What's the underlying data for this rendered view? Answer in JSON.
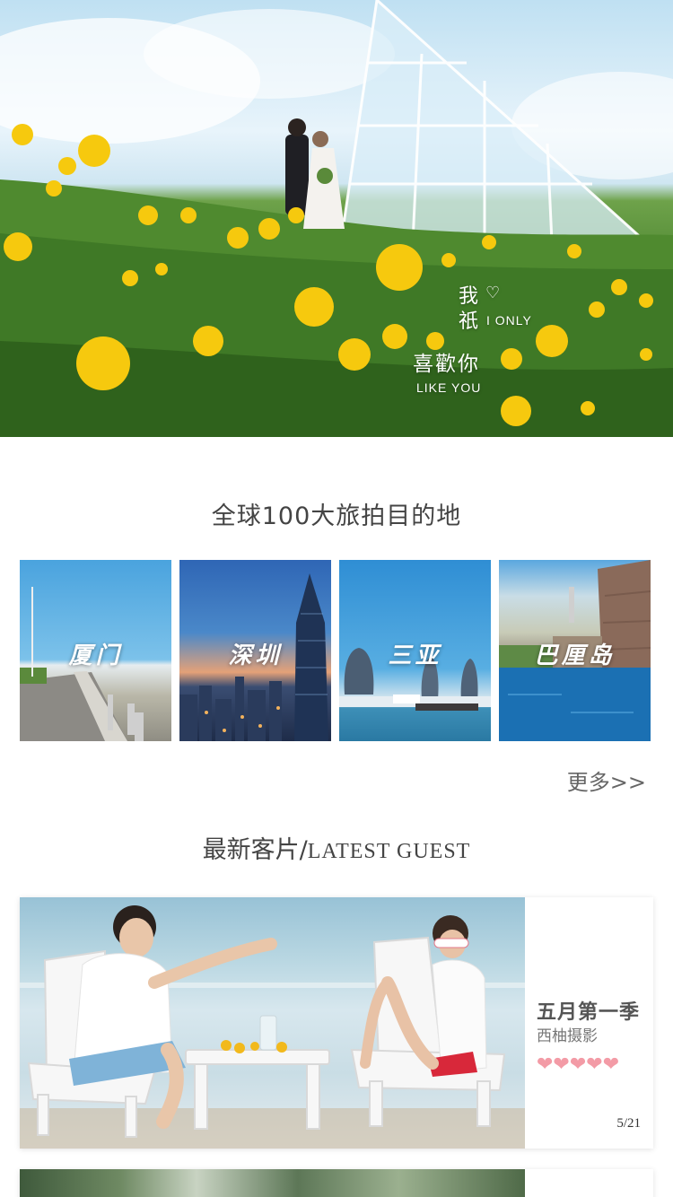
{
  "hero": {
    "line1": "我",
    "heart": "♡",
    "line2": "祇",
    "only": "I ONLY",
    "like": "喜歡你",
    "like_en": "LIKE YOU"
  },
  "destinations": {
    "title": "全球100大旅拍目的地",
    "items": [
      {
        "label": "厦门"
      },
      {
        "label": "深圳"
      },
      {
        "label": "三亚"
      },
      {
        "label": "巴厘岛"
      }
    ],
    "more": "更多>>"
  },
  "guests": {
    "title_cn": "最新客片/",
    "title_en": "LATEST GUEST",
    "card": {
      "title": "五月第一季",
      "studio": "西柚摄影",
      "rating": 5,
      "hearts": "❤❤❤❤❤",
      "page": "5/21"
    }
  },
  "colors": {
    "heart": "#f39ba6",
    "text": "#444444"
  }
}
